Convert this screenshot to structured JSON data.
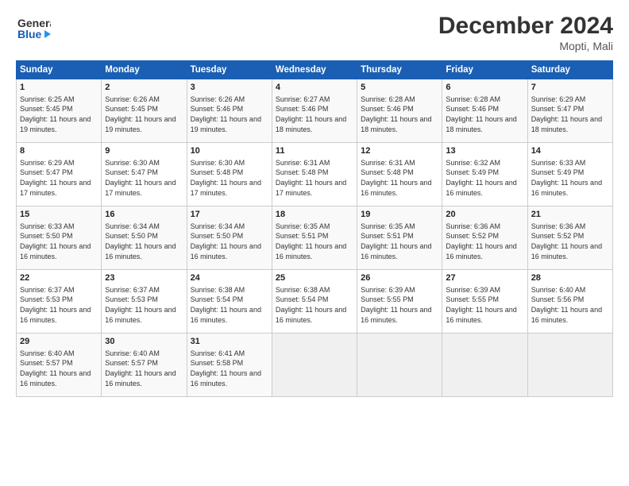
{
  "header": {
    "logo_line1": "General",
    "logo_line2": "Blue",
    "month_year": "December 2024",
    "location": "Mopti, Mali"
  },
  "days_of_week": [
    "Sunday",
    "Monday",
    "Tuesday",
    "Wednesday",
    "Thursday",
    "Friday",
    "Saturday"
  ],
  "weeks": [
    [
      {
        "day": "1",
        "sunrise": "Sunrise: 6:25 AM",
        "sunset": "Sunset: 5:45 PM",
        "daylight": "Daylight: 11 hours and 19 minutes."
      },
      {
        "day": "2",
        "sunrise": "Sunrise: 6:26 AM",
        "sunset": "Sunset: 5:45 PM",
        "daylight": "Daylight: 11 hours and 19 minutes."
      },
      {
        "day": "3",
        "sunrise": "Sunrise: 6:26 AM",
        "sunset": "Sunset: 5:46 PM",
        "daylight": "Daylight: 11 hours and 19 minutes."
      },
      {
        "day": "4",
        "sunrise": "Sunrise: 6:27 AM",
        "sunset": "Sunset: 5:46 PM",
        "daylight": "Daylight: 11 hours and 18 minutes."
      },
      {
        "day": "5",
        "sunrise": "Sunrise: 6:28 AM",
        "sunset": "Sunset: 5:46 PM",
        "daylight": "Daylight: 11 hours and 18 minutes."
      },
      {
        "day": "6",
        "sunrise": "Sunrise: 6:28 AM",
        "sunset": "Sunset: 5:46 PM",
        "daylight": "Daylight: 11 hours and 18 minutes."
      },
      {
        "day": "7",
        "sunrise": "Sunrise: 6:29 AM",
        "sunset": "Sunset: 5:47 PM",
        "daylight": "Daylight: 11 hours and 18 minutes."
      }
    ],
    [
      {
        "day": "8",
        "sunrise": "Sunrise: 6:29 AM",
        "sunset": "Sunset: 5:47 PM",
        "daylight": "Daylight: 11 hours and 17 minutes."
      },
      {
        "day": "9",
        "sunrise": "Sunrise: 6:30 AM",
        "sunset": "Sunset: 5:47 PM",
        "daylight": "Daylight: 11 hours and 17 minutes."
      },
      {
        "day": "10",
        "sunrise": "Sunrise: 6:30 AM",
        "sunset": "Sunset: 5:48 PM",
        "daylight": "Daylight: 11 hours and 17 minutes."
      },
      {
        "day": "11",
        "sunrise": "Sunrise: 6:31 AM",
        "sunset": "Sunset: 5:48 PM",
        "daylight": "Daylight: 11 hours and 17 minutes."
      },
      {
        "day": "12",
        "sunrise": "Sunrise: 6:31 AM",
        "sunset": "Sunset: 5:48 PM",
        "daylight": "Daylight: 11 hours and 16 minutes."
      },
      {
        "day": "13",
        "sunrise": "Sunrise: 6:32 AM",
        "sunset": "Sunset: 5:49 PM",
        "daylight": "Daylight: 11 hours and 16 minutes."
      },
      {
        "day": "14",
        "sunrise": "Sunrise: 6:33 AM",
        "sunset": "Sunset: 5:49 PM",
        "daylight": "Daylight: 11 hours and 16 minutes."
      }
    ],
    [
      {
        "day": "15",
        "sunrise": "Sunrise: 6:33 AM",
        "sunset": "Sunset: 5:50 PM",
        "daylight": "Daylight: 11 hours and 16 minutes."
      },
      {
        "day": "16",
        "sunrise": "Sunrise: 6:34 AM",
        "sunset": "Sunset: 5:50 PM",
        "daylight": "Daylight: 11 hours and 16 minutes."
      },
      {
        "day": "17",
        "sunrise": "Sunrise: 6:34 AM",
        "sunset": "Sunset: 5:50 PM",
        "daylight": "Daylight: 11 hours and 16 minutes."
      },
      {
        "day": "18",
        "sunrise": "Sunrise: 6:35 AM",
        "sunset": "Sunset: 5:51 PM",
        "daylight": "Daylight: 11 hours and 16 minutes."
      },
      {
        "day": "19",
        "sunrise": "Sunrise: 6:35 AM",
        "sunset": "Sunset: 5:51 PM",
        "daylight": "Daylight: 11 hours and 16 minutes."
      },
      {
        "day": "20",
        "sunrise": "Sunrise: 6:36 AM",
        "sunset": "Sunset: 5:52 PM",
        "daylight": "Daylight: 11 hours and 16 minutes."
      },
      {
        "day": "21",
        "sunrise": "Sunrise: 6:36 AM",
        "sunset": "Sunset: 5:52 PM",
        "daylight": "Daylight: 11 hours and 16 minutes."
      }
    ],
    [
      {
        "day": "22",
        "sunrise": "Sunrise: 6:37 AM",
        "sunset": "Sunset: 5:53 PM",
        "daylight": "Daylight: 11 hours and 16 minutes."
      },
      {
        "day": "23",
        "sunrise": "Sunrise: 6:37 AM",
        "sunset": "Sunset: 5:53 PM",
        "daylight": "Daylight: 11 hours and 16 minutes."
      },
      {
        "day": "24",
        "sunrise": "Sunrise: 6:38 AM",
        "sunset": "Sunset: 5:54 PM",
        "daylight": "Daylight: 11 hours and 16 minutes."
      },
      {
        "day": "25",
        "sunrise": "Sunrise: 6:38 AM",
        "sunset": "Sunset: 5:54 PM",
        "daylight": "Daylight: 11 hours and 16 minutes."
      },
      {
        "day": "26",
        "sunrise": "Sunrise: 6:39 AM",
        "sunset": "Sunset: 5:55 PM",
        "daylight": "Daylight: 11 hours and 16 minutes."
      },
      {
        "day": "27",
        "sunrise": "Sunrise: 6:39 AM",
        "sunset": "Sunset: 5:55 PM",
        "daylight": "Daylight: 11 hours and 16 minutes."
      },
      {
        "day": "28",
        "sunrise": "Sunrise: 6:40 AM",
        "sunset": "Sunset: 5:56 PM",
        "daylight": "Daylight: 11 hours and 16 minutes."
      }
    ],
    [
      {
        "day": "29",
        "sunrise": "Sunrise: 6:40 AM",
        "sunset": "Sunset: 5:57 PM",
        "daylight": "Daylight: 11 hours and 16 minutes."
      },
      {
        "day": "30",
        "sunrise": "Sunrise: 6:40 AM",
        "sunset": "Sunset: 5:57 PM",
        "daylight": "Daylight: 11 hours and 16 minutes."
      },
      {
        "day": "31",
        "sunrise": "Sunrise: 6:41 AM",
        "sunset": "Sunset: 5:58 PM",
        "daylight": "Daylight: 11 hours and 16 minutes."
      },
      null,
      null,
      null,
      null
    ]
  ]
}
